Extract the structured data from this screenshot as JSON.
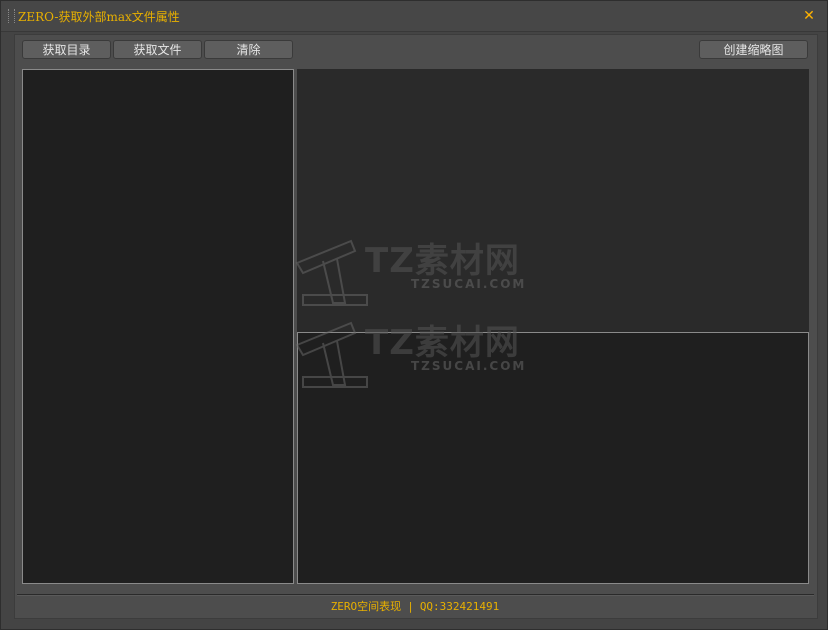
{
  "window": {
    "title": "ZERO-获取外部max文件属性",
    "close_icon": "close-icon"
  },
  "toolbar": {
    "get_dir_label": "获取目录",
    "get_file_label": "获取文件",
    "clear_label": "清除",
    "create_thumb_label": "创建缩略图"
  },
  "footer": {
    "brand": "ZERO空间表现",
    "separator": "|",
    "qq": "QQ:332421491"
  },
  "watermark": {
    "brand": "TZ素材网",
    "domain": "TZSUCAI.COM"
  },
  "colors": {
    "accent": "#e8b000",
    "background": "#444444",
    "list_bg": "#1f1f1f"
  }
}
